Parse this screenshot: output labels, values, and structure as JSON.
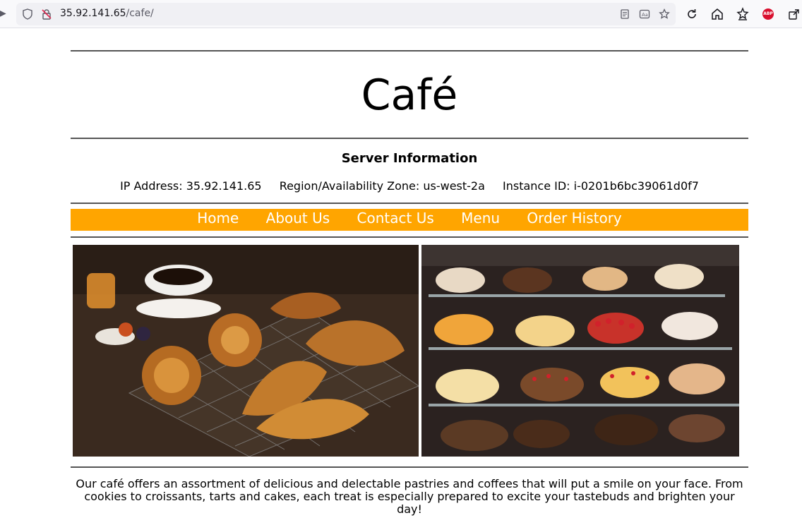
{
  "browser": {
    "url_host": "35.92.141.65",
    "url_path": "/cafe/",
    "icons": [
      "back-icon",
      "shield-icon",
      "insecure-lock-icon",
      "reader-view-icon",
      "translate-icon",
      "bookmark-star-icon",
      "reload-icon",
      "home-icon",
      "extensions-star-icon",
      "adblock-plus-icon",
      "share-icon"
    ],
    "abp_label": "ABP"
  },
  "page": {
    "title": "Café",
    "server_heading": "Server Information",
    "ip": "IP Address: 35.92.141.65",
    "region": "Region/Availability Zone: us-west-2a",
    "instance": "Instance ID: i-0201b6bc39061d0f7",
    "nav": [
      "Home",
      "About Us",
      "Contact Us",
      "Menu",
      "Order History"
    ],
    "description": "Our café offers an assortment of delicious and delectable pastries and coffees that will put a smile on your face. From cookies to croissants, tarts and cakes, each treat is especially prepared to excite your tastebuds and brighten your day!"
  },
  "colors": {
    "nav_bg": "#ffa500",
    "nav_text": "#ffffff"
  }
}
